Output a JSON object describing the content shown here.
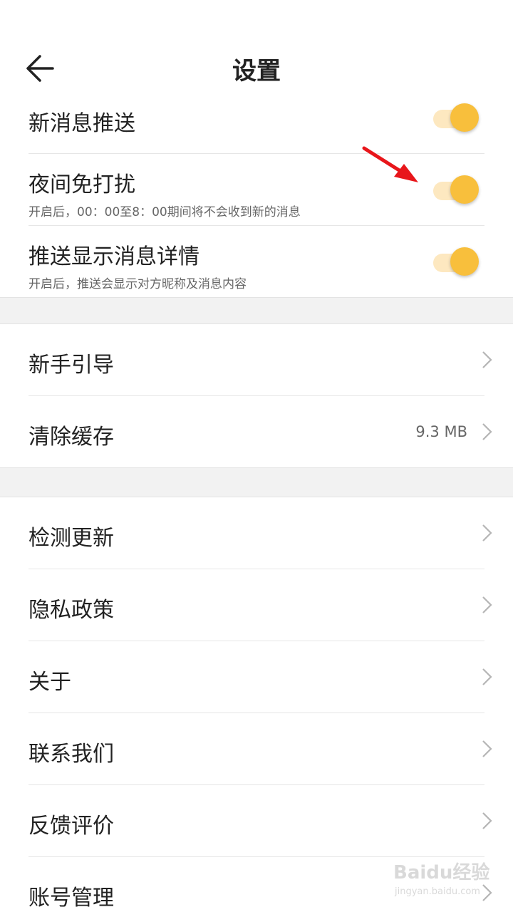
{
  "header": {
    "title": "设置",
    "back_icon": "arrow-left-icon"
  },
  "accent_color": "#f8bf3c",
  "push": {
    "new_message": {
      "label": "新消息推送",
      "on": true
    },
    "dnd": {
      "label": "夜间免打扰",
      "sub": "开启后，00：00至8：00期间将不会收到新的消息",
      "on": true
    },
    "show_detail": {
      "label": "推送显示消息详情",
      "sub": "开启后，推送会显示对方昵称及消息内容",
      "on": true
    }
  },
  "group2": {
    "guide": {
      "label": "新手引导"
    },
    "cache": {
      "label": "清除缓存",
      "value": "9.3 MB"
    }
  },
  "group3": {
    "update": {
      "label": "检测更新"
    },
    "privacy": {
      "label": "隐私政策"
    },
    "about": {
      "label": "关于"
    },
    "contact": {
      "label": "联系我们"
    },
    "feedback": {
      "label": "反馈评价"
    },
    "account": {
      "label": "账号管理"
    }
  },
  "watermark": {
    "brand": "Baidu经验",
    "url": "jingyan.baidu.com"
  }
}
